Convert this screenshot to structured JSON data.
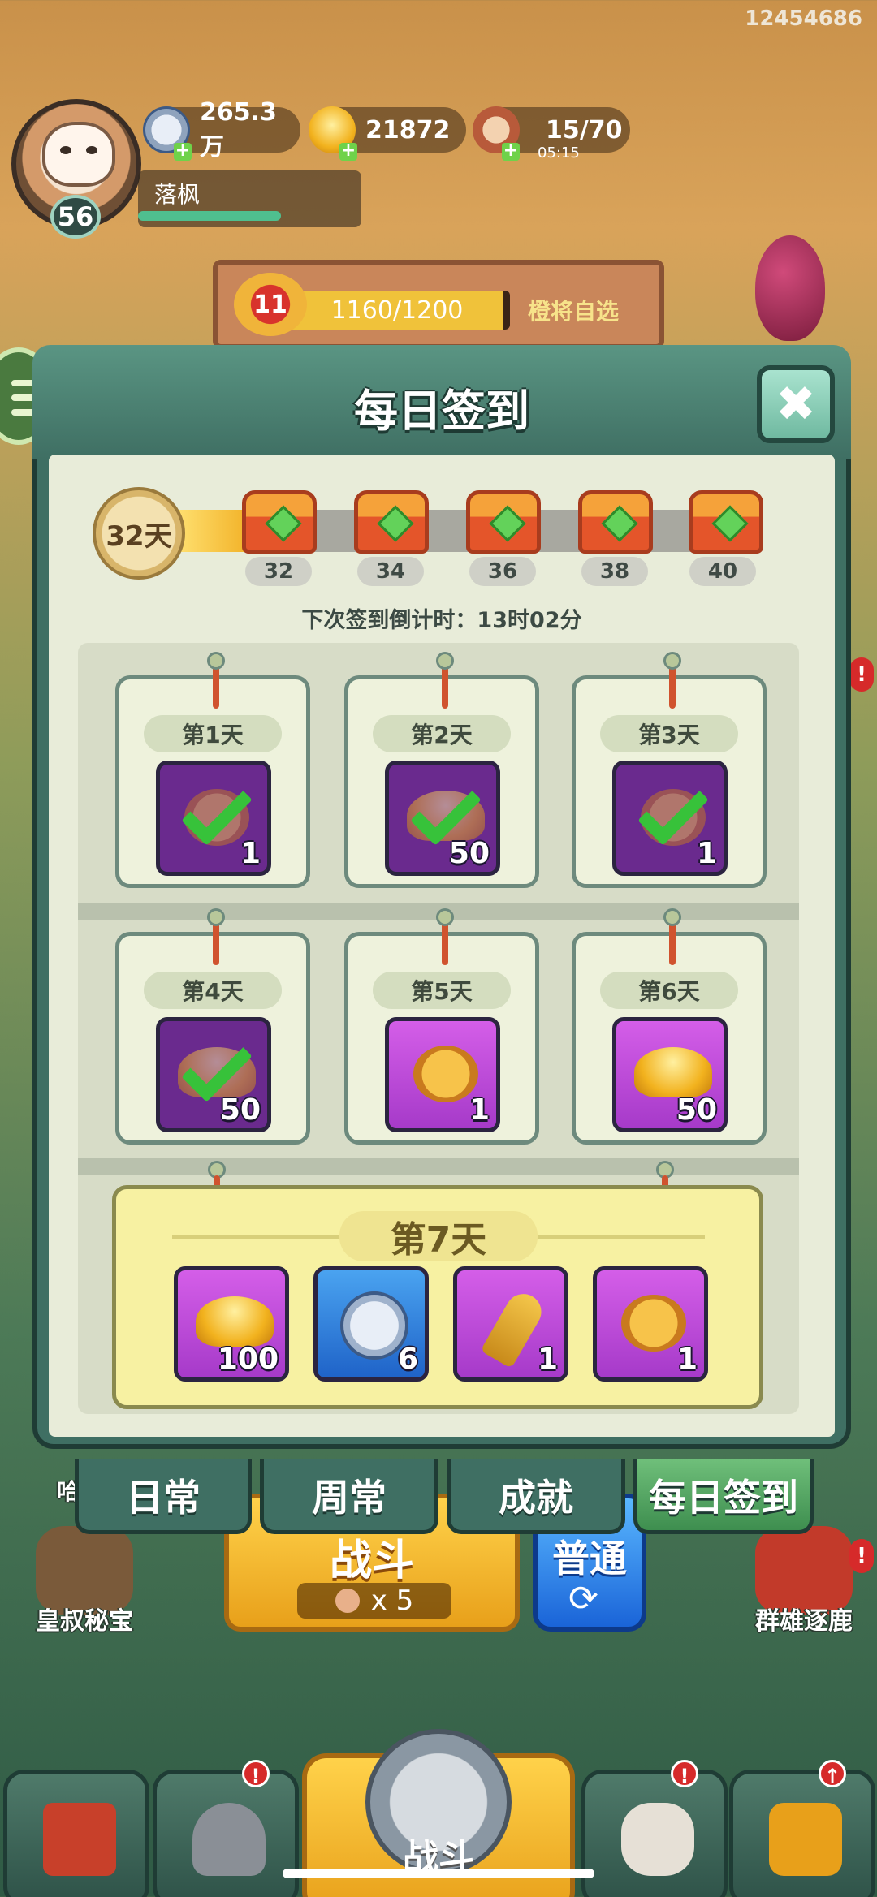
{
  "top": {
    "uid": "12454686"
  },
  "player": {
    "level": "56",
    "name": "落枫",
    "xp_fraction": 0.64,
    "silver": "265.3万",
    "gold": "21872",
    "stamina": "15/70",
    "stamina_timer": "05:15",
    "plus": "+"
  },
  "stage": {
    "level": "11",
    "progress_text": "1160/1200",
    "progress_fraction": 0.967,
    "right_label": "橙将自选"
  },
  "dialog": {
    "title": "每日签到",
    "close_symbol": "✖",
    "days_count": "32天",
    "progress_fraction": 0.12,
    "milestones": [
      "32",
      "34",
      "36",
      "38",
      "40"
    ],
    "countdown": "下次签到倒计时：13时02分",
    "days": [
      {
        "label": "第1天",
        "qty": "1",
        "icon": "check-icon"
      },
      {
        "label": "第2天",
        "qty": "50",
        "icon": "check-icon"
      },
      {
        "label": "第3天",
        "qty": "1",
        "icon": "check-icon"
      },
      {
        "label": "第4天",
        "qty": "50",
        "icon": "check-icon"
      },
      {
        "label": "第5天",
        "qty": "1",
        "icon": "gold-coin-icon"
      },
      {
        "label": "第6天",
        "qty": "50",
        "icon": "gold-ingot-icon"
      }
    ],
    "day7": {
      "label": "第7天",
      "items": [
        {
          "qty": "100",
          "icon": "gold-ingot-icon"
        },
        {
          "qty": "6",
          "icon": "silver-coin-icon"
        },
        {
          "qty": "1",
          "icon": "golden-key-icon"
        },
        {
          "qty": "1",
          "icon": "gold-coin-icon"
        }
      ]
    }
  },
  "tabs": [
    {
      "label": "日常",
      "active": false
    },
    {
      "label": "周常",
      "active": false
    },
    {
      "label": "成就",
      "active": false
    },
    {
      "label": "每日签到",
      "active": true
    }
  ],
  "lower": {
    "battle_label": "战斗",
    "battle_cost": "x 5",
    "mode_label": "普通",
    "left_label": "皇叔秘宝",
    "right_label": "群雄逐鹿",
    "left_side_char": "哈",
    "side_alert": "!"
  },
  "nav": {
    "center_label": "战斗"
  },
  "colors": {
    "dialog": "#3f6f63",
    "panel": "#e8ecd9",
    "active_tab": "#3e8e4f",
    "accent_gold": "#f2b32a"
  }
}
